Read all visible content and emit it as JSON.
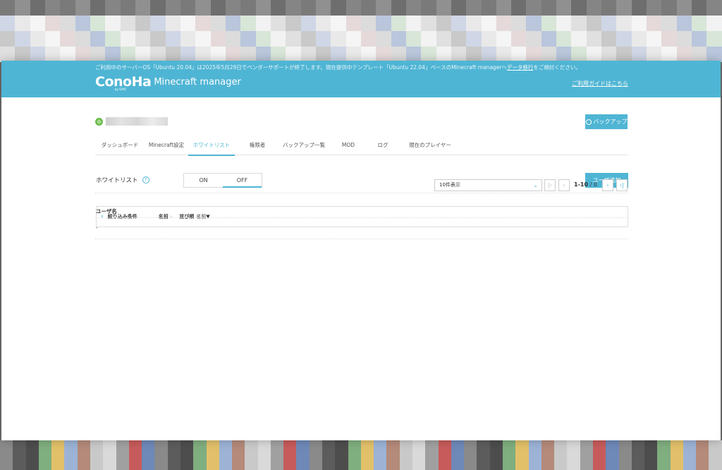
{
  "header": {
    "notice_text": "ご利用中のサーバーOS「Ubuntu 20.04」は2025年5月29日でベンダーサポートが終了します。現在提供中テンプレート「Ubuntu 22.04」ベースのMinecraft managerへ",
    "notice_link": "データ移行",
    "notice_suffix": "をご検討ください。",
    "logo_text": "ConoHa",
    "logo_sub": "by GMO",
    "app_name": "Minecraft manager",
    "guide_link": "ご利用ガイドはこちら"
  },
  "server": {
    "status": "running",
    "backup_label": "バックアップ"
  },
  "tabs": [
    {
      "label": "ダッシュボード",
      "active": false
    },
    {
      "label": "Minecraft設定",
      "active": false
    },
    {
      "label": "ホワイトリスト",
      "active": true
    },
    {
      "label": "権限者",
      "active": false
    },
    {
      "label": "バックアップ一覧",
      "active": false
    },
    {
      "label": "MOD",
      "active": false
    },
    {
      "label": "ログ",
      "active": false
    },
    {
      "label": "現在のプレイヤー",
      "active": false
    }
  ],
  "whitelist": {
    "label": "ホワイトリスト",
    "help_icon": "?",
    "on_label": "ON",
    "off_label": "OFF",
    "selected": "OFF",
    "add_user_label": "ユーザ追加"
  },
  "filter": {
    "title": "絞り込み条件",
    "name_key": "名前",
    "name_value": "-",
    "sort_key": "並び順",
    "sort_value": "名前▼"
  },
  "pagination": {
    "per_page": "10件表示",
    "range": "1-10",
    "total": "/ 0"
  },
  "table": {
    "columns": [
      "ユーザ名"
    ],
    "rows": [
      [
        "-"
      ]
    ]
  },
  "colors": {
    "accent": "#4fb5d4",
    "status_green": "#6bbd4a"
  }
}
